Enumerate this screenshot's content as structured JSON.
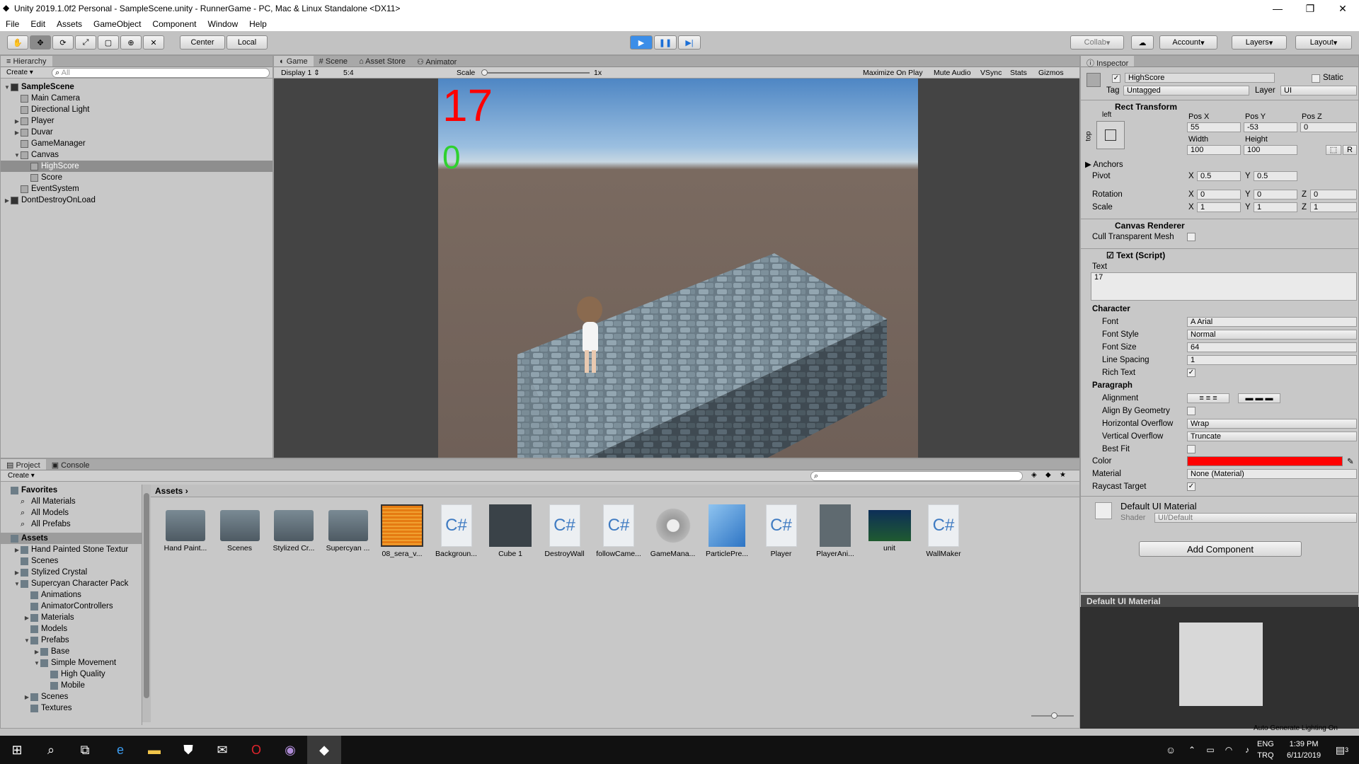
{
  "window": {
    "title": "Unity 2019.1.0f2 Personal - SampleScene.unity - RunnerGame - PC, Mac & Linux Standalone <DX11>",
    "minimize": "—",
    "maximize": "❐",
    "close": "✕"
  },
  "menu": [
    "File",
    "Edit",
    "Assets",
    "GameObject",
    "Component",
    "Window",
    "Help"
  ],
  "toolbar": {
    "center": "Center",
    "local": "Local",
    "collab": "Collab",
    "account": "Account",
    "layers": "Layers",
    "layout": "Layout"
  },
  "hierarchy": {
    "tab": "Hierarchy",
    "create": "Create",
    "search_placeholder": "All",
    "items": [
      {
        "label": "SampleScene",
        "depth": 0,
        "bold": true,
        "arrow": "▼"
      },
      {
        "label": "Main Camera",
        "depth": 1,
        "arrow": ""
      },
      {
        "label": "Directional Light",
        "depth": 1,
        "arrow": ""
      },
      {
        "label": "Player",
        "depth": 1,
        "arrow": "▶"
      },
      {
        "label": "Duvar",
        "depth": 1,
        "arrow": "▶"
      },
      {
        "label": "GameManager",
        "depth": 1,
        "arrow": ""
      },
      {
        "label": "Canvas",
        "depth": 1,
        "arrow": "▼"
      },
      {
        "label": "HighScore",
        "depth": 2,
        "arrow": "",
        "selected": true
      },
      {
        "label": "Score",
        "depth": 2,
        "arrow": ""
      },
      {
        "label": "EventSystem",
        "depth": 1,
        "arrow": ""
      },
      {
        "label": "DontDestroyOnLoad",
        "depth": 0,
        "arrow": "▶"
      }
    ]
  },
  "center_tabs": [
    "Game",
    "Scene",
    "Asset Store",
    "Animator"
  ],
  "game_bar": {
    "display": "Display 1",
    "aspect": "5:4",
    "scale_label": "Scale",
    "scale_val": "1x",
    "buttons": [
      "Maximize On Play",
      "Mute Audio",
      "VSync",
      "Stats",
      "Gizmos"
    ]
  },
  "game": {
    "highscore": "17",
    "score": "0"
  },
  "inspector": {
    "tab": "Inspector",
    "object_name": "HighScore",
    "static": "Static",
    "tag_label": "Tag",
    "tag": "Untagged",
    "layer_label": "Layer",
    "layer": "UI",
    "rect": {
      "title": "Rect Transform",
      "left": "left",
      "top": "top",
      "posx_l": "Pos X",
      "posy_l": "Pos Y",
      "posz_l": "Pos Z",
      "posx": "55",
      "posy": "-53",
      "posz": "0",
      "w_l": "Width",
      "h_l": "Height",
      "w": "100",
      "h": "100",
      "anchors": "Anchors",
      "pivot": "Pivot",
      "px": "0.5",
      "py": "0.5",
      "rotation": "Rotation",
      "rx": "0",
      "ry": "0",
      "rz": "0",
      "scale": "Scale",
      "sx": "1",
      "sy": "1",
      "sz": "1",
      "x": "X",
      "y": "Y",
      "z": "Z",
      "r": "R"
    },
    "canvas_renderer": {
      "title": "Canvas Renderer",
      "cull": "Cull Transparent Mesh"
    },
    "text": {
      "title": "Text (Script)",
      "text_label": "Text",
      "text": "17",
      "character": "Character",
      "font_l": "Font",
      "font": "Arial",
      "style_l": "Font Style",
      "style": "Normal",
      "size_l": "Font Size",
      "size": "64",
      "spacing_l": "Line Spacing",
      "spacing": "1",
      "rich_l": "Rich Text",
      "paragraph": "Paragraph",
      "align_l": "Alignment",
      "geom_l": "Align By Geometry",
      "hover_l": "Horizontal Overflow",
      "hover": "Wrap",
      "vover_l": "Vertical Overflow",
      "vover": "Truncate",
      "best_l": "Best Fit",
      "color_l": "Color",
      "color": "#ff0000",
      "mat_l": "Material",
      "mat": "None (Material)",
      "ray_l": "Raycast Target"
    },
    "material": {
      "title": "Default UI Material",
      "shader_l": "Shader",
      "shader": "UI/Default"
    },
    "add_component": "Add Component",
    "preview_title": "Default UI Material"
  },
  "project": {
    "tabs": [
      "Project",
      "Console"
    ],
    "create": "Create",
    "favorites": "Favorites",
    "fav_items": [
      "All Materials",
      "All Models",
      "All Prefabs"
    ],
    "assets_root": "Assets",
    "tree": [
      {
        "label": "Hand Painted Stone Textur",
        "d": 1,
        "a": "▶"
      },
      {
        "label": "Scenes",
        "d": 1,
        "a": ""
      },
      {
        "label": "Stylized Crystal",
        "d": 1,
        "a": "▶"
      },
      {
        "label": "Supercyan Character Pack",
        "d": 1,
        "a": "▼"
      },
      {
        "label": "Animations",
        "d": 2,
        "a": ""
      },
      {
        "label": "AnimatorControllers",
        "d": 2,
        "a": ""
      },
      {
        "label": "Materials",
        "d": 2,
        "a": "▶"
      },
      {
        "label": "Models",
        "d": 2,
        "a": ""
      },
      {
        "label": "Prefabs",
        "d": 2,
        "a": "▼"
      },
      {
        "label": "Base",
        "d": 3,
        "a": "▶"
      },
      {
        "label": "Simple Movement",
        "d": 3,
        "a": "▼"
      },
      {
        "label": "High Quality",
        "d": 4,
        "a": ""
      },
      {
        "label": "Mobile",
        "d": 4,
        "a": ""
      },
      {
        "label": "Scenes",
        "d": 2,
        "a": "▶"
      },
      {
        "label": "Textures",
        "d": 2,
        "a": ""
      }
    ],
    "breadcrumb": "Assets",
    "items": [
      {
        "label": "Hand Paint...",
        "kind": "folder"
      },
      {
        "label": "Scenes",
        "kind": "folder"
      },
      {
        "label": "Stylized Cr...",
        "kind": "folder"
      },
      {
        "label": "Supercyan ...",
        "kind": "folder"
      },
      {
        "label": "08_sera_v...",
        "kind": "audio"
      },
      {
        "label": "Backgroun...",
        "kind": "cs"
      },
      {
        "label": "Cube 1",
        "kind": "cube-dark"
      },
      {
        "label": "DestroyWall",
        "kind": "cs"
      },
      {
        "label": "followCame...",
        "kind": "cs"
      },
      {
        "label": "GameMana...",
        "kind": "gear"
      },
      {
        "label": "ParticlePre...",
        "kind": "cube-blue"
      },
      {
        "label": "Player",
        "kind": "cs"
      },
      {
        "label": "PlayerAni...",
        "kind": "anim"
      },
      {
        "label": "unit",
        "kind": "scene"
      },
      {
        "label": "WallMaker",
        "kind": "cs"
      }
    ],
    "cs_glyph": "C#"
  },
  "status": {
    "auto_lighting": "Auto Generate Lighting On"
  },
  "taskbar": {
    "lang1": "ENG",
    "lang2": "TRQ",
    "time": "1:39 PM",
    "date": "6/11/2019",
    "notif": "3"
  }
}
